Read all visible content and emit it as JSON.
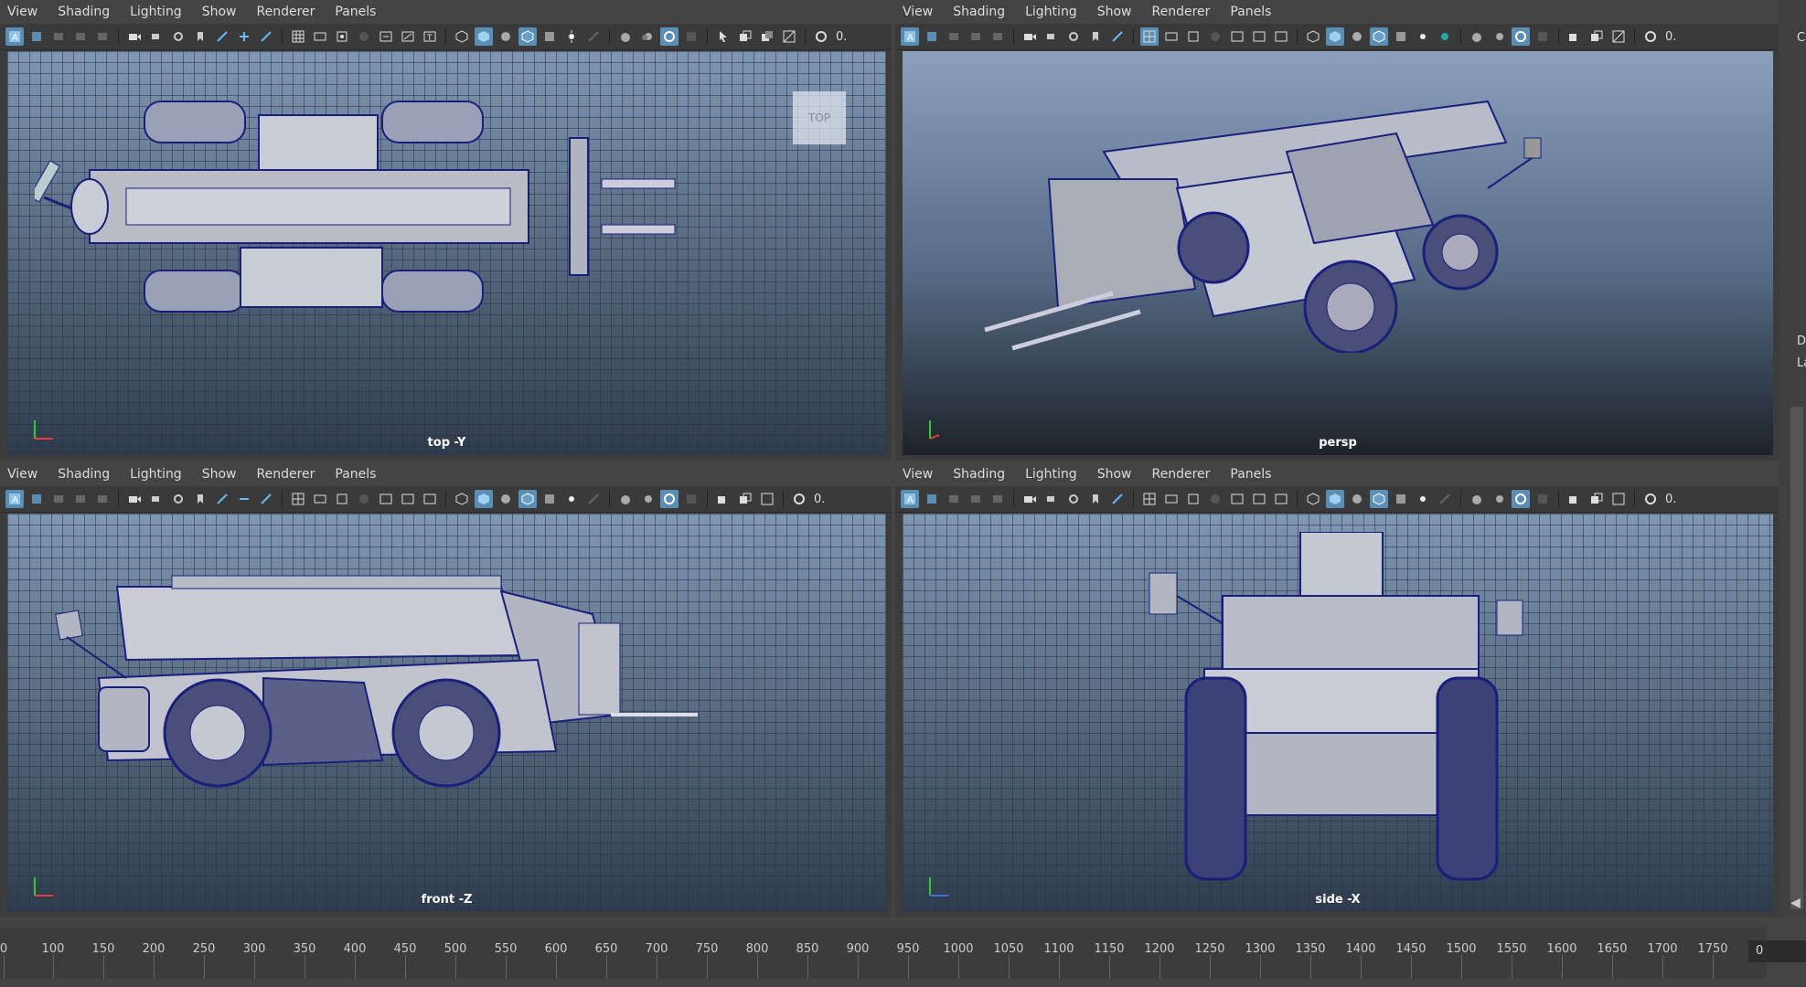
{
  "menu": {
    "view": "View",
    "shading": "Shading",
    "lighting": "Lighting",
    "show": "Show",
    "renderer": "Renderer",
    "panels": "Panels"
  },
  "toolbar": {
    "value": "0."
  },
  "viewports": {
    "top": {
      "label": "top -Y",
      "cube": "TOP"
    },
    "persp": {
      "label": "persp"
    },
    "front": {
      "label": "front -Z"
    },
    "side": {
      "label": "side -X"
    }
  },
  "timeline": {
    "ticks": [
      "0",
      "100",
      "150",
      "200",
      "250",
      "300",
      "350",
      "400",
      "450",
      "500",
      "550",
      "600",
      "650",
      "700",
      "750",
      "800",
      "850",
      "900",
      "950",
      "1000",
      "1050",
      "1100",
      "1150",
      "1200",
      "1250",
      "1300",
      "1350",
      "1400",
      "1450",
      "1500",
      "1550",
      "1600",
      "1650",
      "1700",
      "1750"
    ],
    "current_frame": "0"
  },
  "right_panel": {
    "line1": "Ch",
    "line2": "D",
    "line3": "La"
  },
  "colors": {
    "wire": "#1a1f7a",
    "accent": "#5a8fb3"
  }
}
